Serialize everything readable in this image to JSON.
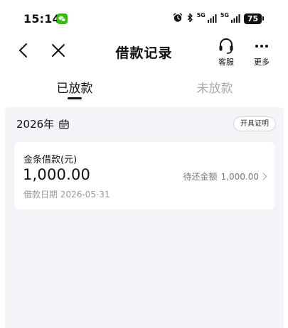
{
  "status_bar": {
    "time": "15:14",
    "signal_1_label": "5G",
    "signal_2_label": "5G",
    "battery": "75"
  },
  "nav": {
    "title": "借款记录",
    "service_label": "客服",
    "more_label": "更多"
  },
  "tabs": {
    "disbursed": "已放款",
    "undisbursed": "未放款"
  },
  "records": {
    "year": "2026年",
    "certificate_button": "开具证明",
    "items": [
      {
        "name": "金条借款(元)",
        "amount": "1,000.00",
        "pending_label": "待还金额",
        "pending_amount": "1,000.00",
        "date": "借款日期 2026-05-31"
      }
    ]
  },
  "colors": {
    "wechat_green": "#2dc100",
    "background_gray": "#f4f4f8",
    "text_primary": "#111111",
    "text_secondary": "#9a9a9a"
  }
}
